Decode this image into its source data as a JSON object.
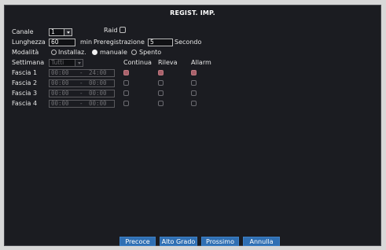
{
  "title": "REGIST. IMP.",
  "canale": {
    "label": "Canale",
    "value": "1"
  },
  "raid": {
    "label": "Raid",
    "checked": false
  },
  "lunghezza": {
    "label": "Lunghezza",
    "value": "60",
    "unit": "min"
  },
  "preregistrazione": {
    "label": "Preregistrazione",
    "value": "5",
    "unit": "Secondo"
  },
  "modalita": {
    "label": "Modalità",
    "options": [
      "Installaz.",
      "manuale",
      "Spento"
    ],
    "selected": "manuale"
  },
  "settimana": {
    "label": "Settimana",
    "value": "Tutti"
  },
  "columns": [
    "Continua",
    "Rileva",
    "Allarm"
  ],
  "fasce": [
    {
      "label": "Fascia 1",
      "start": "00:00",
      "sep": "-",
      "end": "24:00",
      "continua": true,
      "rileva": true,
      "allarm": true
    },
    {
      "label": "Fascia 2",
      "start": "00:00",
      "sep": "-",
      "end": "00:00",
      "continua": false,
      "rileva": false,
      "allarm": false
    },
    {
      "label": "Fascia 3",
      "start": "00:00",
      "sep": "-",
      "end": "00:00",
      "continua": false,
      "rileva": false,
      "allarm": false
    },
    {
      "label": "Fascia 4",
      "start": "00:00",
      "sep": "-",
      "end": "00:00",
      "continua": false,
      "rileva": false,
      "allarm": false
    }
  ],
  "buttons": {
    "precoce": "Precoce",
    "alto_grado": "Alto Grado",
    "prossimo": "Prossimo",
    "annulla": "Annulla"
  },
  "colors": {
    "window_bg": "#1b1c21",
    "button_bg": "#2f6fb3",
    "checked_box": "#a8606a"
  }
}
